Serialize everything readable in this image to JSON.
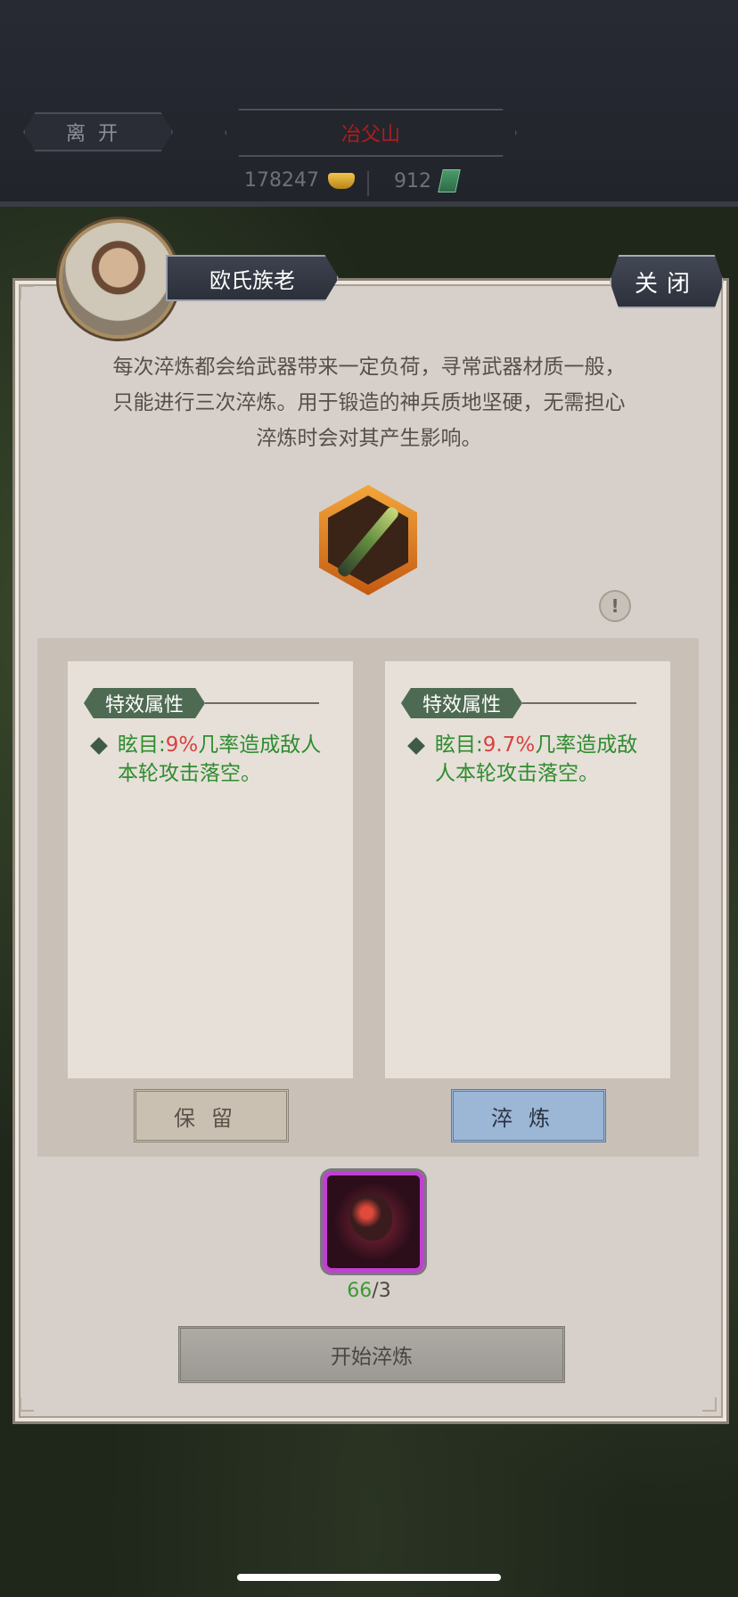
{
  "topbar": {
    "leave_label": "离开",
    "location": "冶父山",
    "gold": "178247",
    "jade": "912"
  },
  "dialog": {
    "npc_name": "欧氏族老",
    "close_label": "关闭",
    "description_lines": [
      "每次淬炼都会给武器带来一定负荷，寻常武器材质一般，",
      "只能进行三次淬炼。用于锻造的神兵质地坚硬，无需担心",
      "淬炼时会对其产生影响。"
    ],
    "info_symbol": "!",
    "left_card": {
      "tag": "特效属性",
      "attr_prefix": "眩目:",
      "attr_value": "9%",
      "attr_suffix": "几率造成敌人本轮攻击落空。"
    },
    "right_card": {
      "tag": "特效属性",
      "attr_prefix": "眩目:",
      "attr_value": "9.7%",
      "attr_suffix": "几率造成敌人本轮攻击落空。"
    },
    "keep_label": "保留",
    "refine_label": "淬炼",
    "material_have": "66",
    "material_need": "/3",
    "start_label": "开始淬炼"
  },
  "colors": {
    "accent_red": "#d8433e",
    "accent_green": "#2f8c2e",
    "material_border": "#c13fd3"
  },
  "icons": [
    "gold-ingot-icon",
    "jade-icon",
    "weapon-spear-icon",
    "info-icon",
    "material-ore-icon",
    "diamond-bullet-icon"
  ]
}
